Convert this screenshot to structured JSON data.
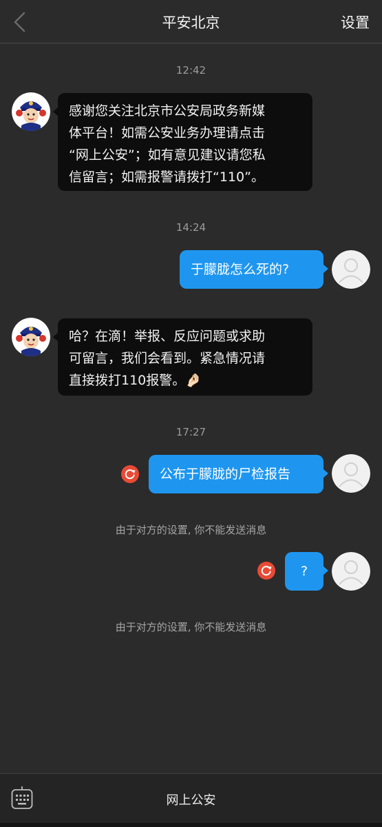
{
  "header": {
    "title": "平安北京",
    "settings_label": "设置",
    "back_icon": "chevron-left-icon"
  },
  "messages": {
    "ts1": "12:42",
    "m1_l1": "感谢您关注北京市公安局政务新媒",
    "m1_l2": "体平台！如需公安业务办理请点击",
    "m1_l3": "“网上公安”；如有意见建议请您私",
    "m1_l4": "信留言；如需报警请拨打“110”。",
    "ts2": "14:24",
    "m2": "于朦胧怎么死的?",
    "m3_l1": "哈？在滴！举报、反应问题或求助",
    "m3_l2": "可留言，我们会看到。紧急情况请",
    "m3_l3": "直接拨打110报警。",
    "m3_emoji": "🤌🏻",
    "ts3": "17:27",
    "m4": "公布于朦胧的尸检报告",
    "note1": "由于对方的设置, 你不能发送消息",
    "m5": "?",
    "note2": "由于对方的设置, 你不能发送消息"
  },
  "bottom": {
    "link_label": "网上公安",
    "keyboard_icon": "keyboard-icon"
  },
  "colors": {
    "background": "#2b2b2b",
    "incoming_bubble": "#0d0d0d",
    "outgoing_bubble": "#1e96f0",
    "retry": "#e94a35"
  }
}
